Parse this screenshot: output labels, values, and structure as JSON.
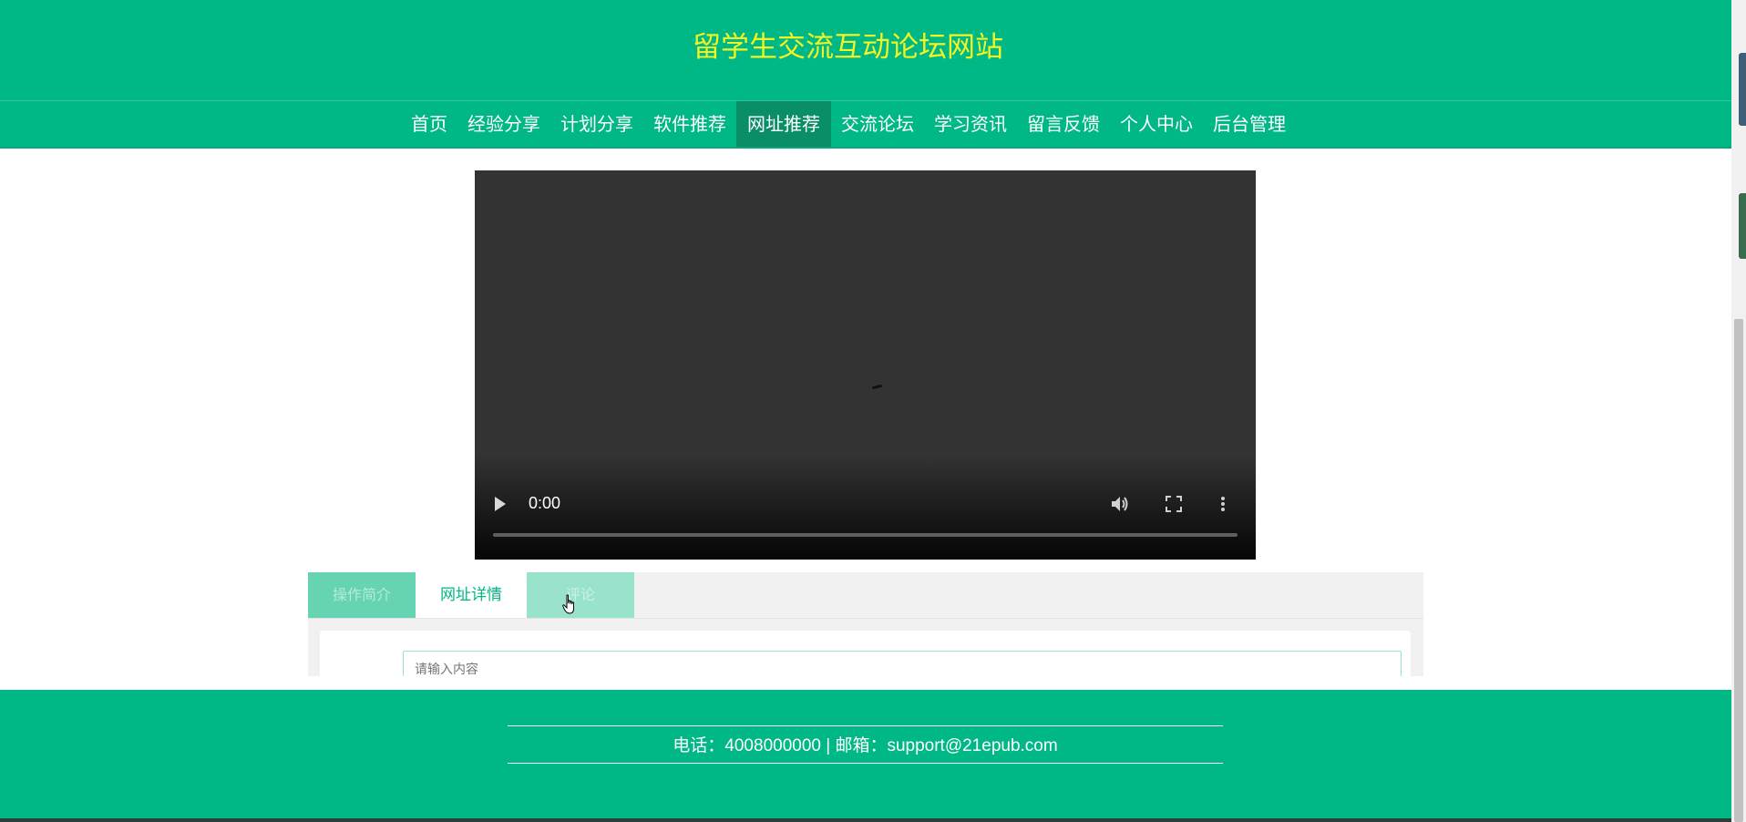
{
  "header": {
    "site_title": "留学生交流互动论坛网站"
  },
  "nav": {
    "items": [
      {
        "label": "首页"
      },
      {
        "label": "经验分享"
      },
      {
        "label": "计划分享"
      },
      {
        "label": "软件推荐"
      },
      {
        "label": "网址推荐"
      },
      {
        "label": "交流论坛"
      },
      {
        "label": "学习资讯"
      },
      {
        "label": "留言反馈"
      },
      {
        "label": "个人中心"
      },
      {
        "label": "后台管理"
      }
    ],
    "active": "网址推荐"
  },
  "video": {
    "current_time": "0:00",
    "progress": 0,
    "icons": {
      "play": "play-icon",
      "volume": "volume-icon",
      "fullscreen": "fullscreen-icon",
      "more": "more-vertical-icon"
    }
  },
  "tabs": {
    "items": [
      {
        "label": "操作简介"
      },
      {
        "label": "网址详情"
      },
      {
        "label": "评论"
      }
    ],
    "active": "网址详情"
  },
  "comment": {
    "placeholder": "请输入内容"
  },
  "footer": {
    "contact": "电话：4008000000 | 邮箱：support@21epub.com"
  },
  "colors": {
    "brand_green": "#00b786",
    "title_yellow": "#f1f523",
    "active_nav": "#0a8e68",
    "video_bg": "#333333"
  }
}
